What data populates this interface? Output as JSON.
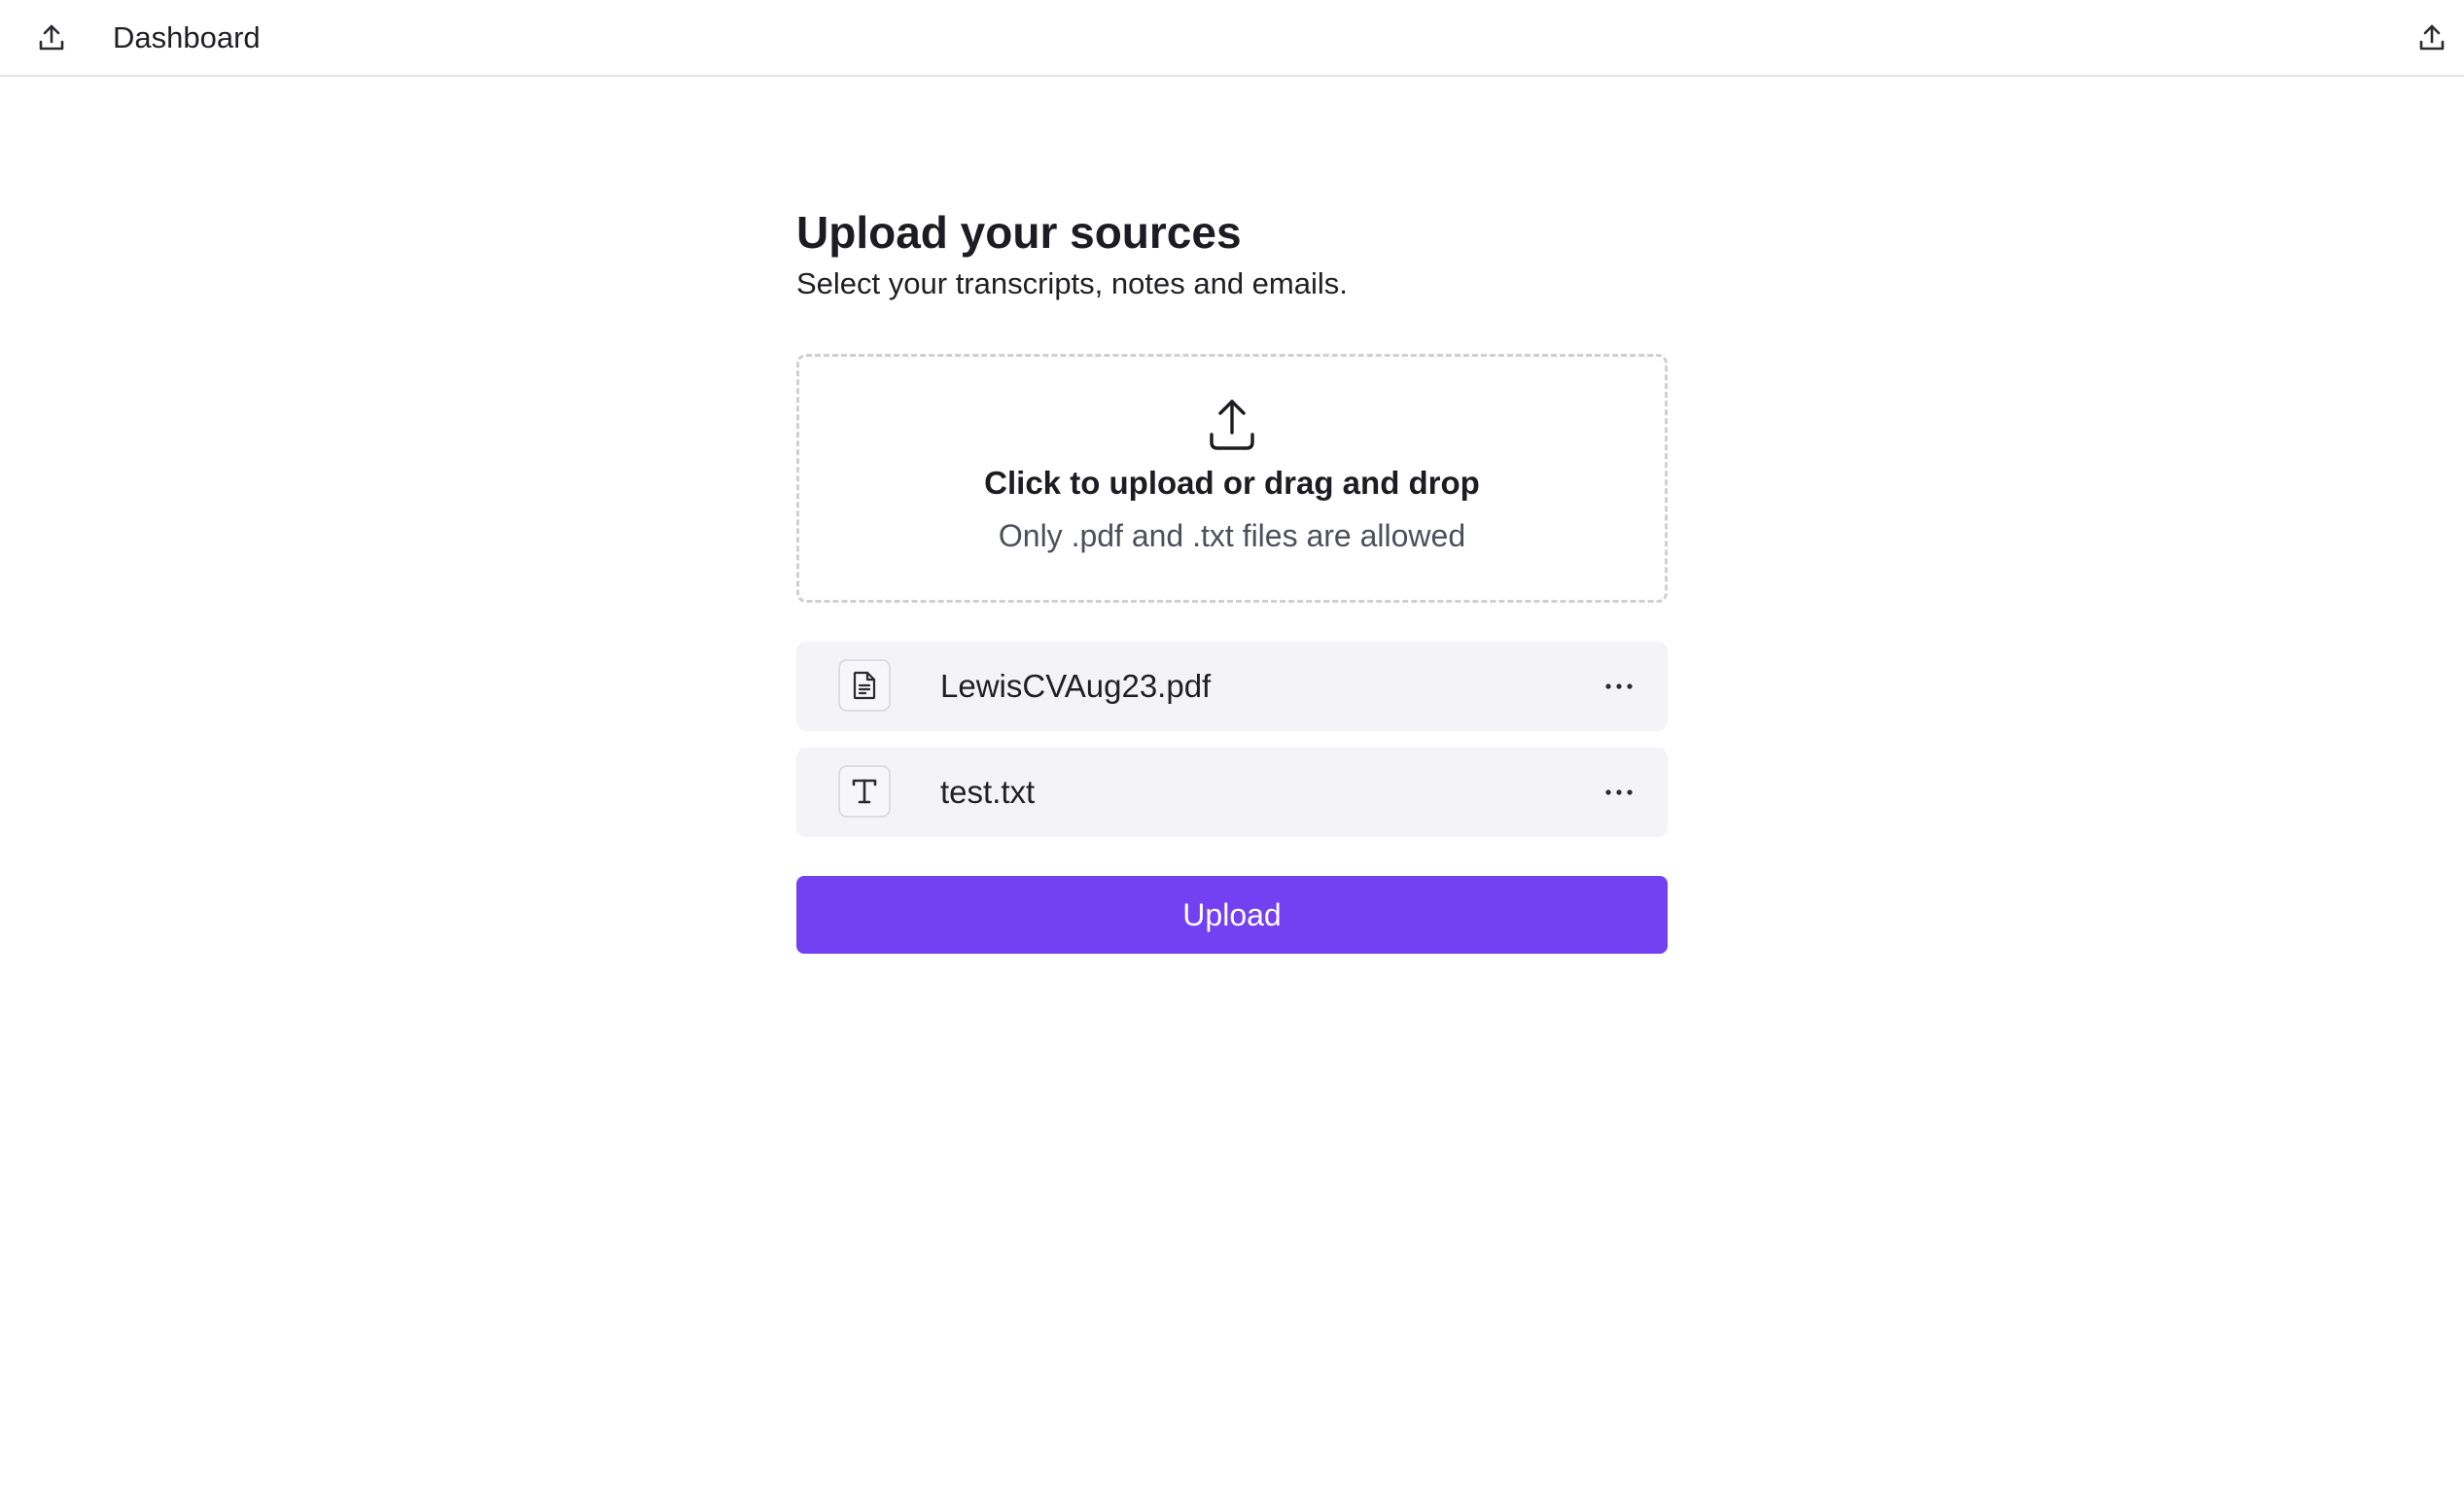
{
  "topbar": {
    "title": "Dashboard",
    "left_icon": "upload-icon",
    "right_icon": "share-upload-icon"
  },
  "main": {
    "title": "Upload your sources",
    "subtitle": "Select your transcripts, notes and emails."
  },
  "dropzone": {
    "icon": "upload-tray-icon",
    "title": "Click to upload or drag and drop",
    "hint": "Only .pdf and .txt files are allowed"
  },
  "files": [
    {
      "name": "LewisCVAug23.pdf",
      "type_icon": "document-icon",
      "menu_icon": "more-horizontal-icon"
    },
    {
      "name": "test.txt",
      "type_icon": "text-t-icon",
      "menu_icon": "more-horizontal-icon"
    }
  ],
  "actions": {
    "upload_label": "Upload"
  },
  "colors": {
    "accent": "#7341f2",
    "file_row_bg": "#f4f4f8",
    "dropzone_border": "#cfcfd4",
    "hint_text": "#4d4f5c"
  }
}
